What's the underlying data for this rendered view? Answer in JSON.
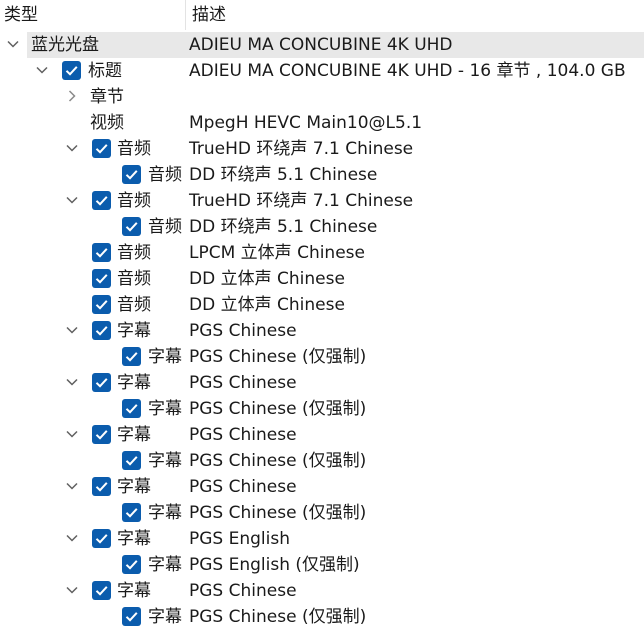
{
  "header": {
    "col_type": "类型",
    "col_desc": "描述"
  },
  "colors": {
    "checkbox": "#0b5cad",
    "selection": "#e8e8e8",
    "chevron": "#606060"
  },
  "icons": {
    "expanded": "chevron-down-icon",
    "collapsed": "chevron-right-icon",
    "checked": "checkmark-icon"
  },
  "rows": [
    {
      "level": 0,
      "chevron": "expanded",
      "checkbox": false,
      "type": "蓝光光盘",
      "desc": "ADIEU MA CONCUBINE 4K UHD",
      "selected": true
    },
    {
      "level": 1,
      "chevron": "expanded",
      "checkbox": true,
      "type": "标题",
      "desc": "ADIEU MA CONCUBINE 4K UHD - 16 章节 , 104.0 GB"
    },
    {
      "level": 2,
      "chevron": "collapsed",
      "checkbox": false,
      "type": "章节",
      "desc": ""
    },
    {
      "level": 2,
      "chevron": "none",
      "checkbox": false,
      "type": "视频",
      "desc": "MpegH HEVC Main10@L5.1"
    },
    {
      "level": 2,
      "chevron": "expanded",
      "checkbox": true,
      "type": "音频",
      "desc": "TrueHD 环绕声 7.1 Chinese"
    },
    {
      "level": 3,
      "chevron": "none",
      "checkbox": true,
      "type": "音频",
      "desc": "DD 环绕声 5.1 Chinese"
    },
    {
      "level": 2,
      "chevron": "expanded",
      "checkbox": true,
      "type": "音频",
      "desc": "TrueHD 环绕声 7.1 Chinese"
    },
    {
      "level": 3,
      "chevron": "none",
      "checkbox": true,
      "type": "音频",
      "desc": "DD 环绕声 5.1 Chinese"
    },
    {
      "level": 2,
      "chevron": "none",
      "checkbox": true,
      "type": "音频",
      "desc": "LPCM 立体声 Chinese"
    },
    {
      "level": 2,
      "chevron": "none",
      "checkbox": true,
      "type": "音频",
      "desc": "DD 立体声 Chinese"
    },
    {
      "level": 2,
      "chevron": "none",
      "checkbox": true,
      "type": "音频",
      "desc": "DD 立体声 Chinese"
    },
    {
      "level": 2,
      "chevron": "expanded",
      "checkbox": true,
      "type": "字幕",
      "desc": "PGS Chinese"
    },
    {
      "level": 3,
      "chevron": "none",
      "checkbox": true,
      "type": "字幕",
      "desc": "PGS Chinese  (仅强制)"
    },
    {
      "level": 2,
      "chevron": "expanded",
      "checkbox": true,
      "type": "字幕",
      "desc": "PGS Chinese"
    },
    {
      "level": 3,
      "chevron": "none",
      "checkbox": true,
      "type": "字幕",
      "desc": "PGS Chinese  (仅强制)"
    },
    {
      "level": 2,
      "chevron": "expanded",
      "checkbox": true,
      "type": "字幕",
      "desc": "PGS Chinese"
    },
    {
      "level": 3,
      "chevron": "none",
      "checkbox": true,
      "type": "字幕",
      "desc": "PGS Chinese  (仅强制)"
    },
    {
      "level": 2,
      "chevron": "expanded",
      "checkbox": true,
      "type": "字幕",
      "desc": "PGS Chinese"
    },
    {
      "level": 3,
      "chevron": "none",
      "checkbox": true,
      "type": "字幕",
      "desc": "PGS Chinese  (仅强制)"
    },
    {
      "level": 2,
      "chevron": "expanded",
      "checkbox": true,
      "type": "字幕",
      "desc": "PGS English"
    },
    {
      "level": 3,
      "chevron": "none",
      "checkbox": true,
      "type": "字幕",
      "desc": "PGS English  (仅强制)"
    },
    {
      "level": 2,
      "chevron": "expanded",
      "checkbox": true,
      "type": "字幕",
      "desc": "PGS Chinese"
    },
    {
      "level": 3,
      "chevron": "none",
      "checkbox": true,
      "type": "字幕",
      "desc": "PGS Chinese  (仅强制)"
    }
  ]
}
